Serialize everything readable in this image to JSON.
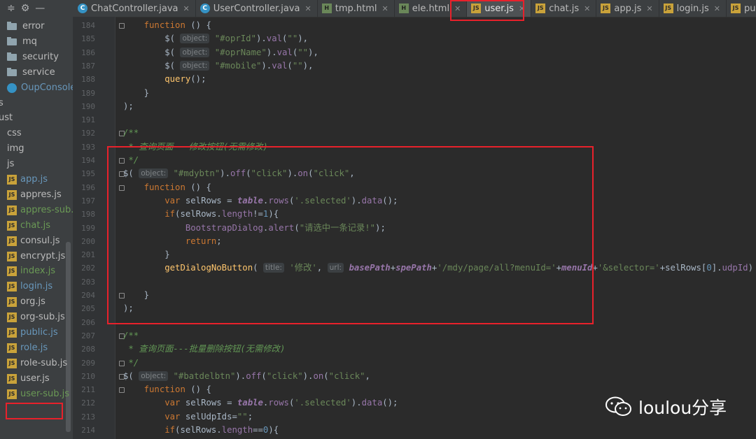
{
  "toolbar": {
    "icons": [
      "collapse-icon",
      "gear-icon",
      "minus-icon"
    ]
  },
  "tabs": [
    {
      "label": "ChatController.java",
      "type": "java"
    },
    {
      "label": "UserController.java",
      "type": "java"
    },
    {
      "label": "tmp.html",
      "type": "html"
    },
    {
      "label": "ele.html",
      "type": "html"
    },
    {
      "label": "user.js",
      "type": "js",
      "active": true
    },
    {
      "label": "chat.js",
      "type": "js"
    },
    {
      "label": "app.js",
      "type": "js"
    },
    {
      "label": "login.js",
      "type": "js"
    },
    {
      "label": "public",
      "type": "js"
    }
  ],
  "icon_labels": {
    "java": "C",
    "html": "H",
    "js": "JS"
  },
  "sidebar": {
    "items": [
      {
        "label": "error"
      },
      {
        "label": "mq"
      },
      {
        "label": "security"
      },
      {
        "label": "service"
      },
      {
        "label": "OupConsoleApp"
      },
      {
        "label": "s"
      },
      {
        "label": "ust"
      },
      {
        "label": "css"
      },
      {
        "label": "img"
      },
      {
        "label": "js"
      },
      {
        "label": "app.js"
      },
      {
        "label": "appres.js"
      },
      {
        "label": "appres-sub.js"
      },
      {
        "label": "chat.js"
      },
      {
        "label": "consul.js"
      },
      {
        "label": "encrypt.js"
      },
      {
        "label": "index.js"
      },
      {
        "label": "login.js"
      },
      {
        "label": "org.js"
      },
      {
        "label": "org-sub.js"
      },
      {
        "label": "public.js"
      },
      {
        "label": "role.js"
      },
      {
        "label": "role-sub.js"
      },
      {
        "label": "user.js"
      },
      {
        "label": "user-sub.js"
      }
    ]
  },
  "code": {
    "line_numbers": [
      "184",
      "185",
      "186",
      "187",
      "188",
      "189",
      "190",
      "191",
      "192",
      "193",
      "194",
      "195",
      "196",
      "197",
      "198",
      "199",
      "200",
      "201",
      "202",
      "203",
      "204",
      "205",
      "206",
      "207",
      "208",
      "209",
      "210",
      "211",
      "212",
      "213",
      "214"
    ],
    "lines": [
      "    function () {",
      "        $( object: \"#oprId\").val(\"\"),",
      "        $( object: \"#oprName\").val(\"\"),",
      "        $( object: \"#mobile\").val(\"\"),",
      "        query();",
      "    }",
      ");",
      "",
      "/**",
      " * 查询页面---修改按钮(无需修改)",
      " */",
      "$( object: \"#mdybtn\").off(\"click\").on(\"click\",",
      "    function () {",
      "        var selRows = table.rows('.selected').data();",
      "        if(selRows.length!=1){",
      "            BootstrapDialog.alert(\"请选中一条记录!\");",
      "            return;",
      "        }",
      "        getDialogNoButton( title: '修改', url: basePath+spePath+'/mdy/page/all?menuId='+menuId+'&selector='+selRows[0].udpId)",
      "",
      "    }",
      ");",
      "",
      "/**",
      " * 查询页面---批量删除按钮(无需修改)",
      " */",
      "$( object: \"#batdelbtn\").off(\"click\").on(\"click\",",
      "    function () {",
      "        var selRows = table.rows('.selected').data();",
      "        var selUdpIds=\"\";",
      "        if(selRows.length==0){"
    ]
  },
  "watermark": {
    "text": "loulou分享",
    "icon": "wechat-icon"
  }
}
